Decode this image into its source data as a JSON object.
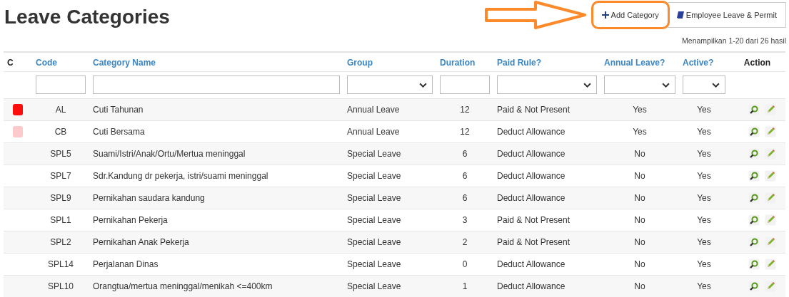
{
  "title": "Leave Categories",
  "buttons": [
    {
      "label": "Add Category",
      "kind": "add",
      "highlighted": true
    },
    {
      "label": "Employee Leave & Permit",
      "kind": "link",
      "highlighted": false
    }
  ],
  "result_count": "Menampilkan 1-20 dari 26 hasil",
  "columns": [
    {
      "label": "C",
      "sortable": false
    },
    {
      "label": "Code",
      "sortable": true
    },
    {
      "label": "Category Name",
      "sortable": true
    },
    {
      "label": "Group",
      "sortable": true
    },
    {
      "label": "Duration",
      "sortable": true
    },
    {
      "label": "Paid Rule?",
      "sortable": true
    },
    {
      "label": "Annual Leave?",
      "sortable": true
    },
    {
      "label": "Active?",
      "sortable": true
    },
    {
      "label": "Action",
      "sortable": false
    }
  ],
  "filters": [
    {
      "kind": "none"
    },
    {
      "kind": "text"
    },
    {
      "kind": "text"
    },
    {
      "kind": "select"
    },
    {
      "kind": "text"
    },
    {
      "kind": "select"
    },
    {
      "kind": "select"
    },
    {
      "kind": "select"
    },
    {
      "kind": "none"
    }
  ],
  "rows": [
    {
      "color": "#fc0d0d",
      "code": "AL",
      "name": "Cuti Tahunan",
      "group": "Annual Leave",
      "duration": "12",
      "paid_rule": "Paid & Not Present",
      "annual_leave": "Yes",
      "active": "Yes"
    },
    {
      "color": "#fccacb",
      "code": "CB",
      "name": "Cuti Bersama",
      "group": "Annual Leave",
      "duration": "12",
      "paid_rule": "Deduct Allowance",
      "annual_leave": "Yes",
      "active": "Yes"
    },
    {
      "code": "SPL5",
      "name": "Suami/Istri/Anak/Ortu/Mertua meninggal",
      "group": "Special Leave",
      "duration": "6",
      "paid_rule": "Deduct Allowance",
      "annual_leave": "No",
      "active": "Yes"
    },
    {
      "code": "SPL7",
      "name": "Sdr.Kandung dr pekerja, istri/suami meninggal",
      "group": "Special Leave",
      "duration": "6",
      "paid_rule": "Deduct Allowance",
      "annual_leave": "No",
      "active": "Yes"
    },
    {
      "code": "SPL9",
      "name": "Pernikahan saudara kandung",
      "group": "Special Leave",
      "duration": "6",
      "paid_rule": "Deduct Allowance",
      "annual_leave": "No",
      "active": "Yes"
    },
    {
      "code": "SPL1",
      "name": "Pernikahan Pekerja",
      "group": "Special Leave",
      "duration": "3",
      "paid_rule": "Paid & Not Present",
      "annual_leave": "No",
      "active": "Yes"
    },
    {
      "code": "SPL2",
      "name": "Pernikahan Anak Pekerja",
      "group": "Special Leave",
      "duration": "2",
      "paid_rule": "Paid & Not Present",
      "annual_leave": "No",
      "active": "Yes"
    },
    {
      "code": "SPL14",
      "name": "Perjalanan Dinas",
      "group": "Special Leave",
      "duration": "0",
      "paid_rule": "Deduct Allowance",
      "annual_leave": "No",
      "active": "Yes"
    },
    {
      "code": "SPL10",
      "name": "Orangtua/mertua meninggal/menikah <=400km",
      "group": "Special Leave",
      "duration": "1",
      "paid_rule": "Deduct Allowance",
      "annual_leave": "No",
      "active": "Yes"
    }
  ]
}
